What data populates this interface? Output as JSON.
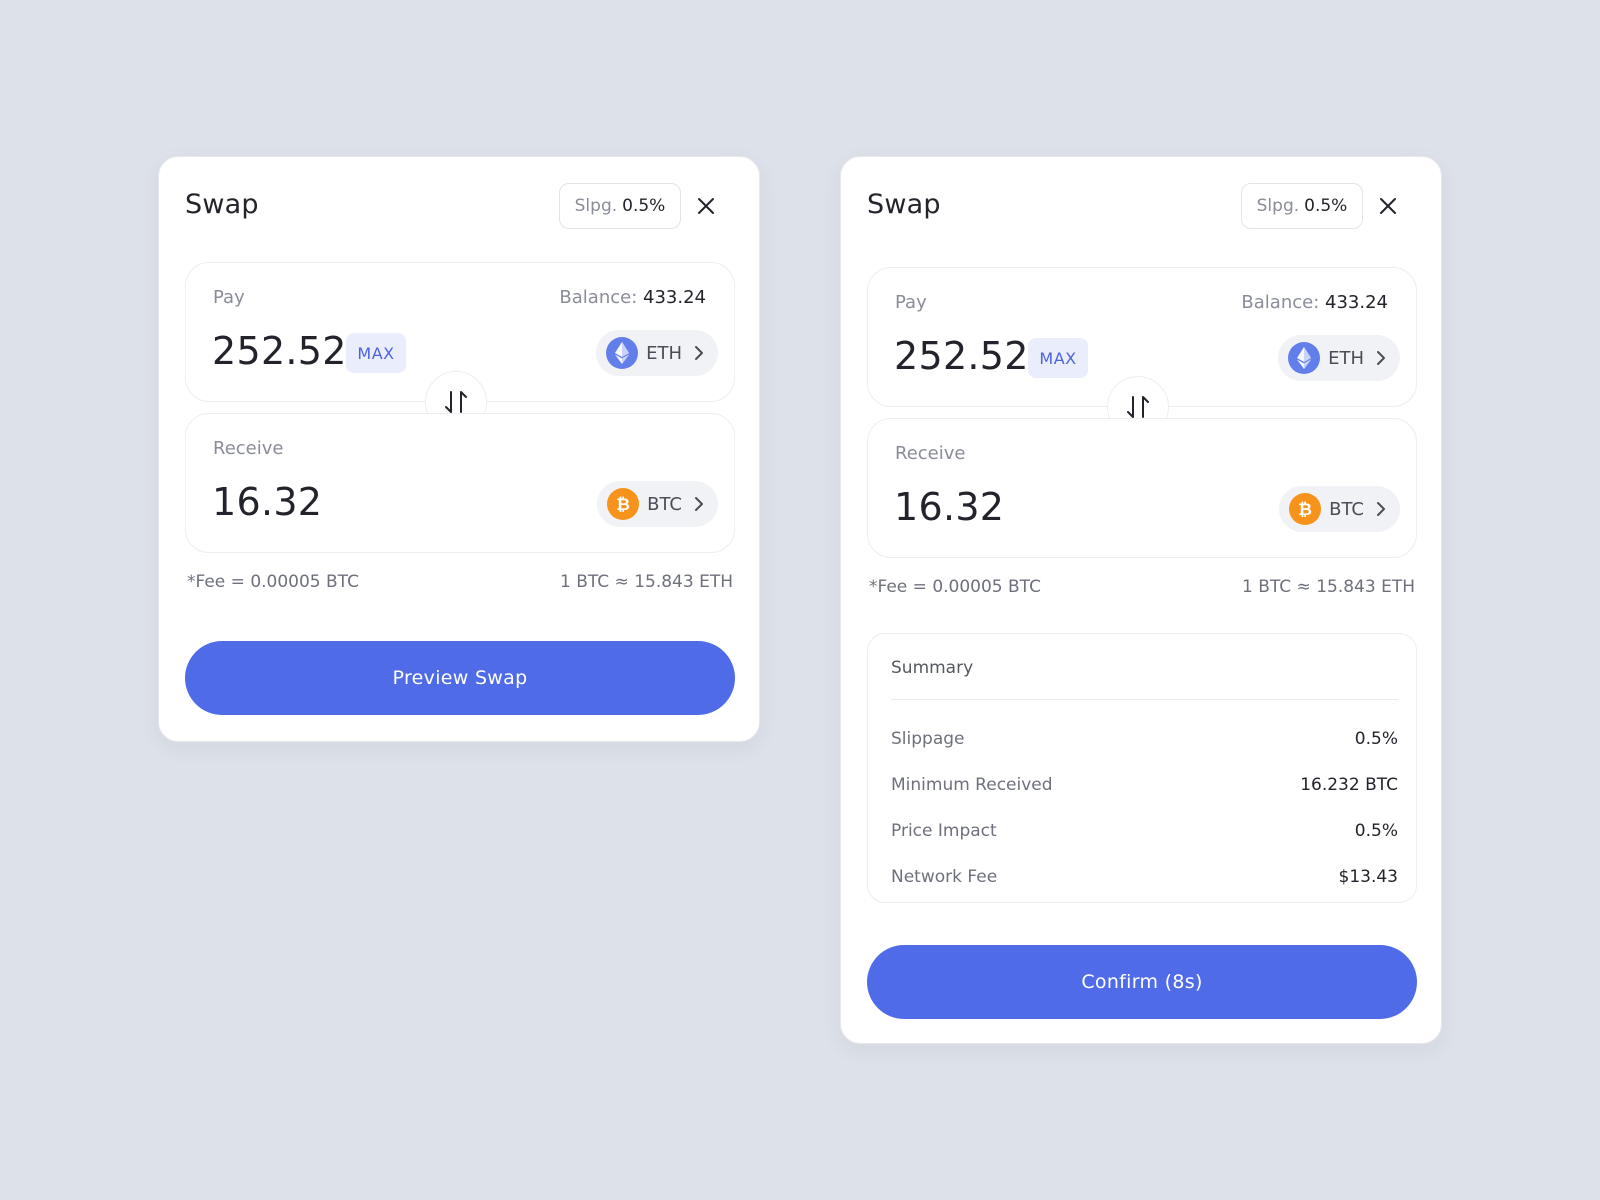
{
  "colors": {
    "background": "#dde1e9",
    "accent": "#4f6be8",
    "eth": "#627eea",
    "btc": "#f7931a"
  },
  "icons": {
    "close": "close-icon",
    "swap": "swap-arrows-icon",
    "eth": "ethereum-icon",
    "btc": "bitcoin-icon",
    "chevron": "chevron-right-icon"
  },
  "preview_card": {
    "title": "Swap",
    "slippage_label": "Slpg.",
    "slippage_value": "0.5%",
    "pay": {
      "label": "Pay",
      "balance_label": "Balance:",
      "balance_value": "433.24",
      "amount": "252.52",
      "max_label": "MAX",
      "token": "ETH"
    },
    "receive": {
      "label": "Receive",
      "amount": "16.32",
      "token": "BTC"
    },
    "fee": "*Fee = 0.00005 BTC",
    "rate": "1 BTC ≈ 15.843 ETH",
    "button_label": "Preview Swap"
  },
  "confirm_card": {
    "title": "Swap",
    "slippage_label": "Slpg.",
    "slippage_value": "0.5%",
    "pay": {
      "label": "Pay",
      "balance_label": "Balance:",
      "balance_value": "433.24",
      "amount": "252.52",
      "max_label": "MAX",
      "token": "ETH"
    },
    "receive": {
      "label": "Receive",
      "amount": "16.32",
      "token": "BTC"
    },
    "fee": "*Fee = 0.00005 BTC",
    "rate": "1 BTC ≈ 15.843 ETH",
    "summary": {
      "title": "Summary",
      "rows": [
        {
          "label": "Slippage",
          "value": "0.5%"
        },
        {
          "label": "Minimum Received",
          "value": "16.232 BTC"
        },
        {
          "label": "Price Impact",
          "value": "0.5%"
        },
        {
          "label": "Network Fee",
          "value": "$13.43"
        }
      ]
    },
    "button_label": "Confirm (8s)"
  }
}
